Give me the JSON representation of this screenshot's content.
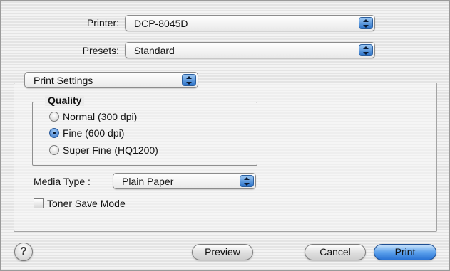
{
  "printer": {
    "label": "Printer:",
    "value": "DCP-8045D"
  },
  "presets": {
    "label": "Presets:",
    "value": "Standard"
  },
  "pane_selector": {
    "value": "Print Settings"
  },
  "quality": {
    "title": "Quality",
    "options": [
      {
        "label": "Normal (300 dpi)",
        "selected": false
      },
      {
        "label": "Fine (600 dpi)",
        "selected": true
      },
      {
        "label": "Super Fine (HQ1200)",
        "selected": false
      }
    ]
  },
  "media_type": {
    "label": "Media Type :",
    "value": "Plain Paper"
  },
  "toner_save": {
    "label": "Toner Save Mode",
    "checked": false
  },
  "buttons": {
    "help": "?",
    "preview": "Preview",
    "cancel": "Cancel",
    "print": "Print"
  },
  "icons": {
    "popup_arrows": "up-down-arrows-icon",
    "help": "question-mark-icon"
  },
  "colors": {
    "accent": "#2a73d4",
    "background": "#ececec"
  }
}
